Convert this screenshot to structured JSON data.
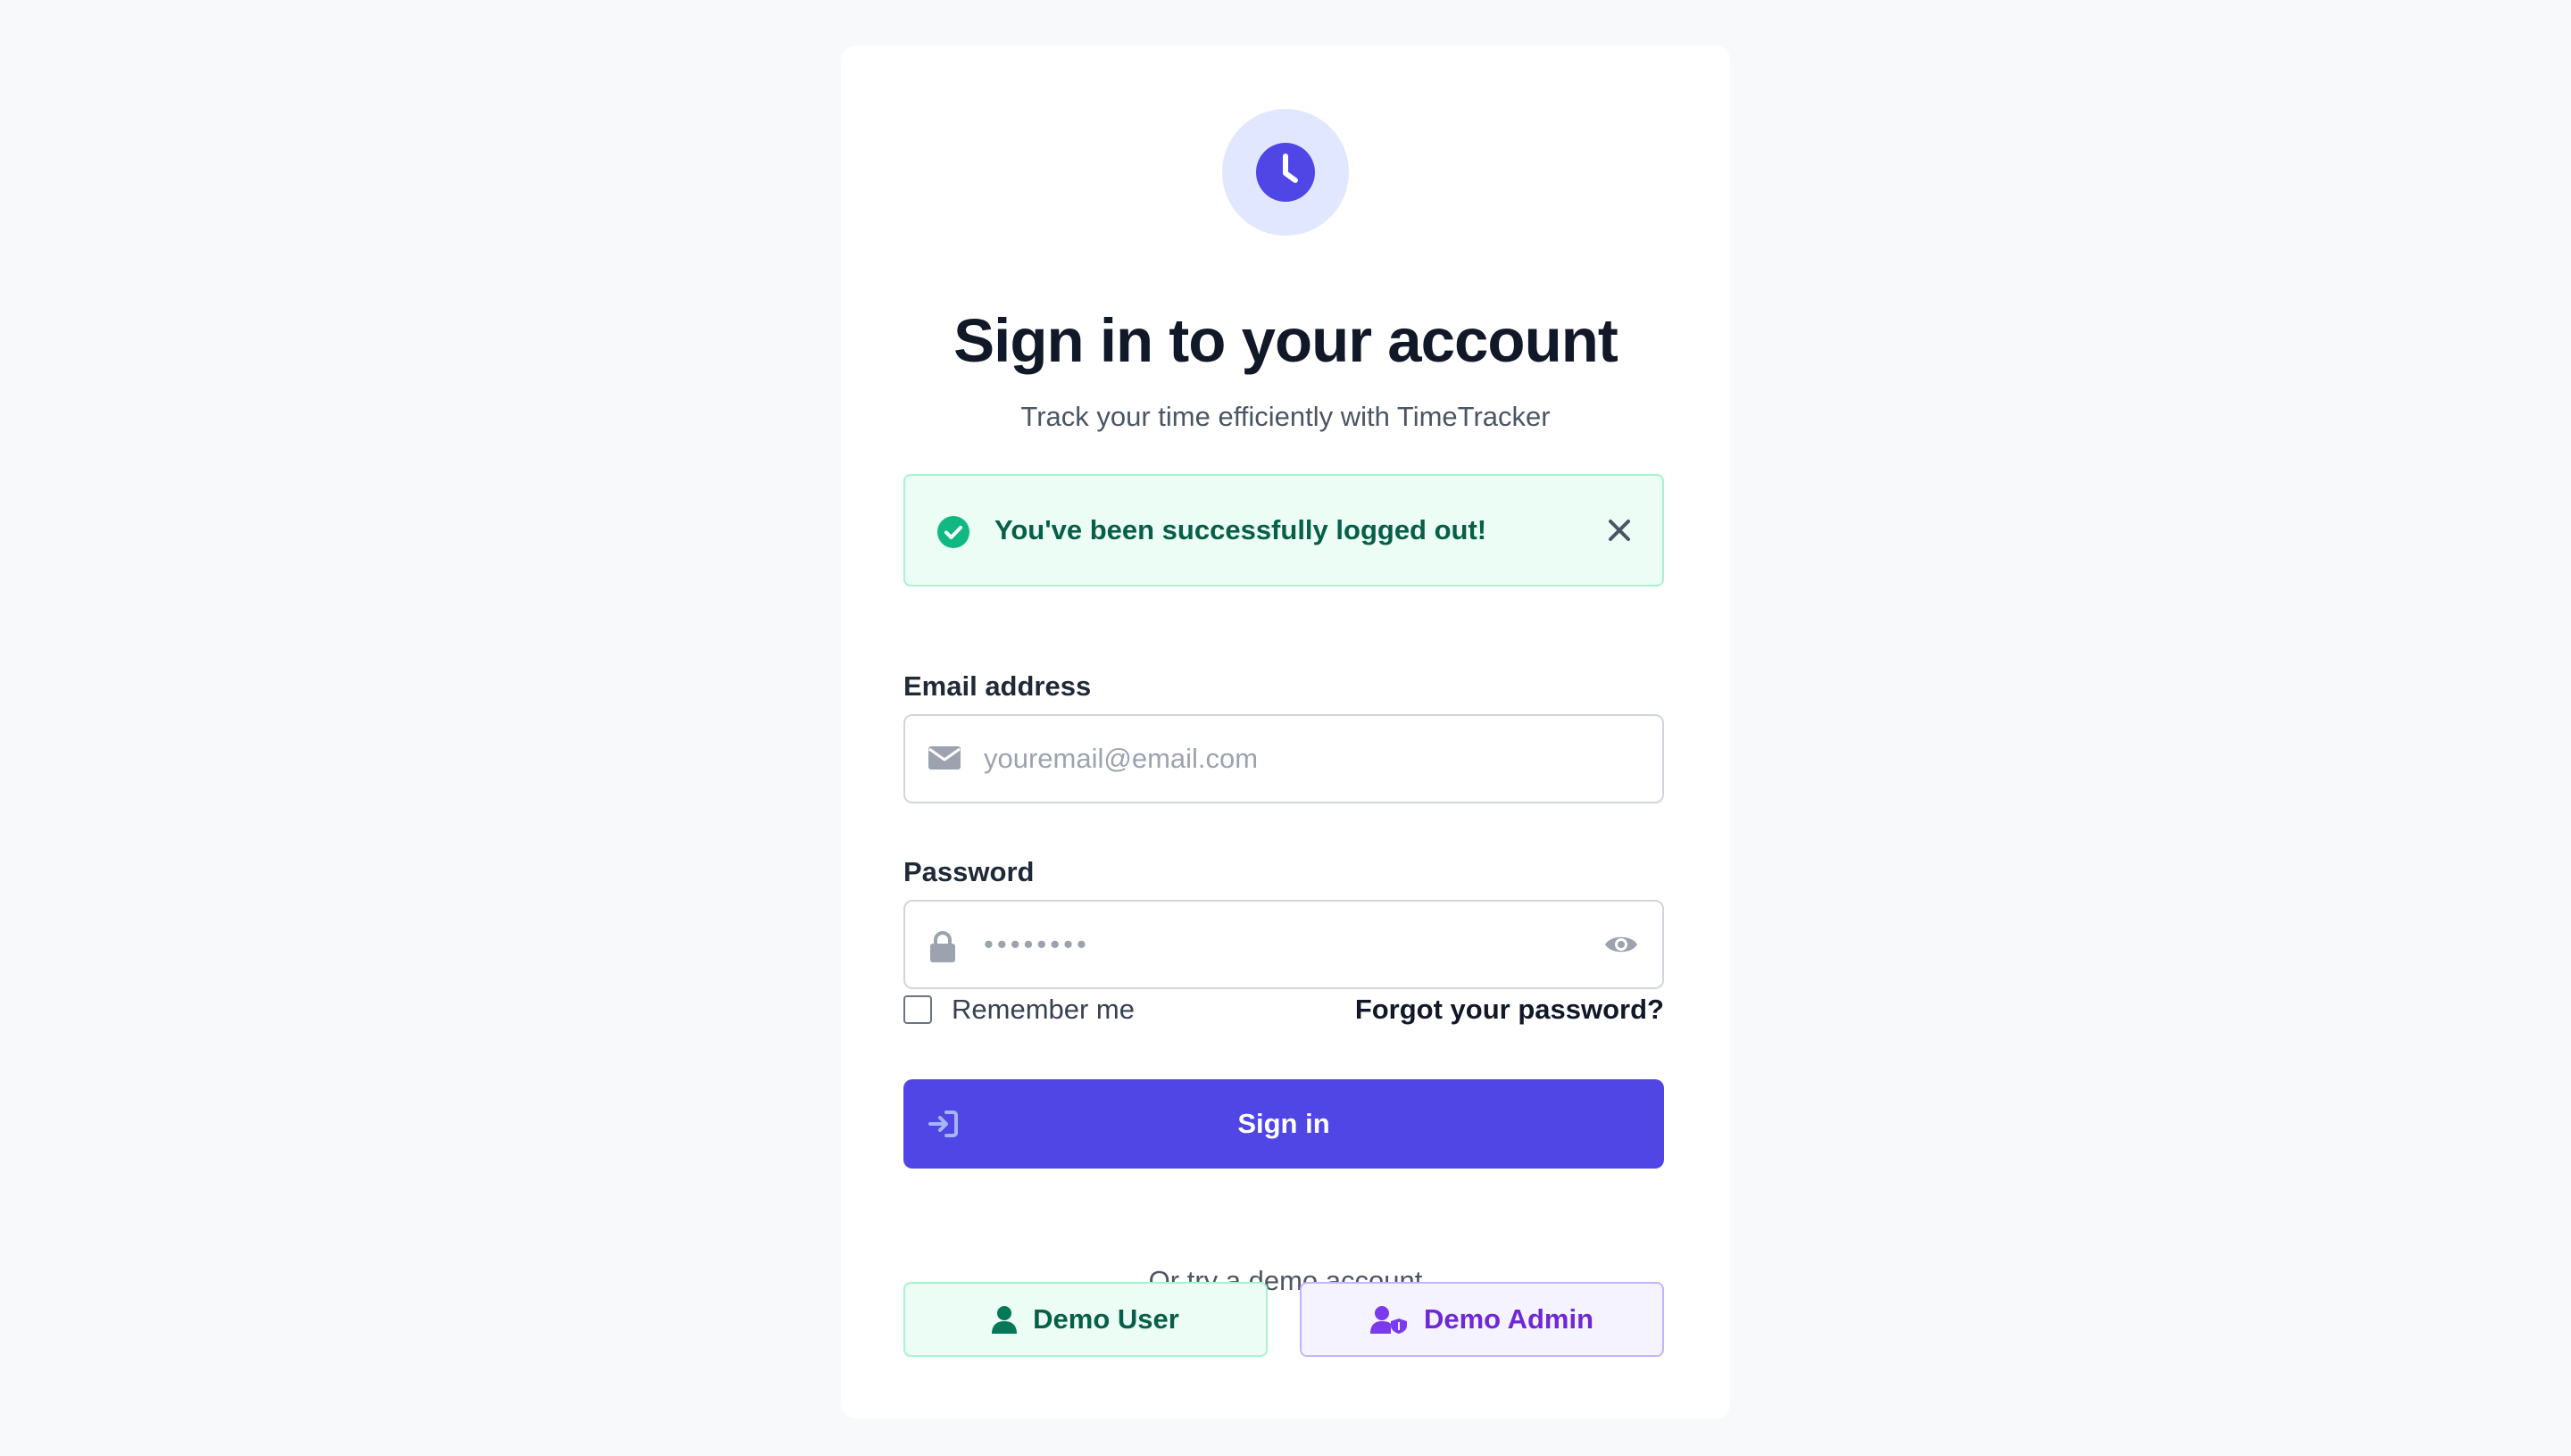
{
  "header": {
    "logo_icon": "clock-icon",
    "title": "Sign in to your account",
    "subtitle": "Track your time efficiently with TimeTracker"
  },
  "alert": {
    "icon": "check-circle-icon",
    "message": "You've been successfully logged out!",
    "close_icon": "close-icon",
    "color": "#065f46"
  },
  "form": {
    "email": {
      "label": "Email address",
      "icon": "envelope-icon",
      "placeholder": "youremail@email.com",
      "value": ""
    },
    "password": {
      "label": "Password",
      "icon": "lock-icon",
      "placeholder": "••••••••",
      "value": "",
      "toggle_icon": "eye-icon"
    },
    "remember_me": {
      "label": "Remember me",
      "checked": false
    },
    "forgot_link": "Forgot your password?",
    "submit": {
      "label": "Sign in",
      "icon": "sign-in-icon",
      "color": "#4f46e5"
    }
  },
  "demo": {
    "caption": "Or try a demo account",
    "user_button": {
      "label": "Demo User",
      "icon": "user-icon",
      "color": "#065f46"
    },
    "admin_button": {
      "label": "Demo Admin",
      "icon": "user-shield-icon",
      "color": "#6d28d9"
    }
  }
}
